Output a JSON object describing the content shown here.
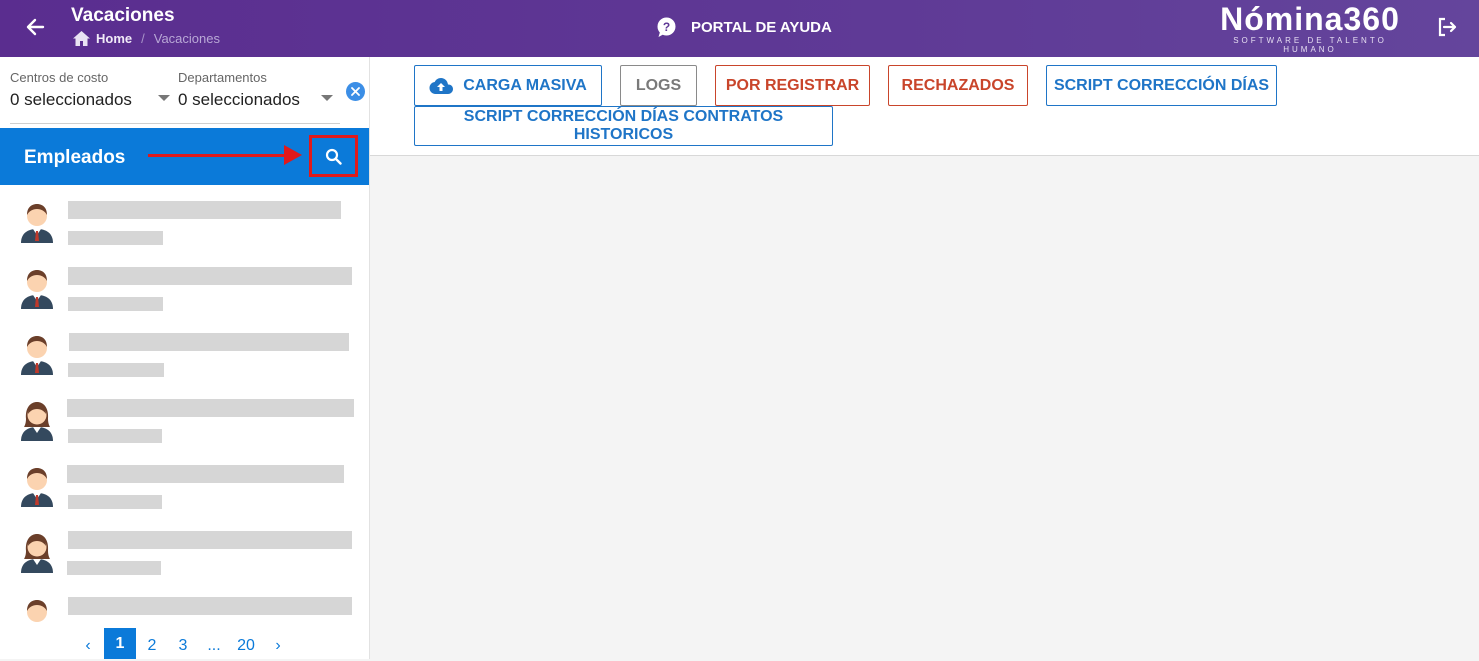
{
  "header": {
    "title": "Vacaciones",
    "breadcrumb": {
      "home": "Home",
      "separator": "/",
      "current": "Vacaciones"
    },
    "help_label": "PORTAL DE AYUDA",
    "brand": {
      "name": "Nómina360",
      "tagline": "SOFTWARE DE TALENTO HUMANO"
    },
    "icons": {
      "back": "arrow-left-icon",
      "home": "home-icon",
      "help": "help-circle-icon",
      "logout": "logout-icon"
    },
    "color": "#5e3795"
  },
  "filters": {
    "cost_centers": {
      "label": "Centros de costo",
      "value": "0 seleccionados"
    },
    "departments": {
      "label": "Departamentos",
      "value": "0 seleccionados"
    },
    "clear_icon": "clear-circle-icon"
  },
  "employees": {
    "title": "Empleados",
    "search_icon": "search-icon",
    "highlight_color": "#e0191b",
    "header_color": "#0b7ad9",
    "items": [
      {
        "avatar": "male-avatar"
      },
      {
        "avatar": "male-avatar"
      },
      {
        "avatar": "male-avatar"
      },
      {
        "avatar": "female-avatar"
      },
      {
        "avatar": "male-avatar"
      },
      {
        "avatar": "female-avatar"
      },
      {
        "avatar": "male-avatar"
      }
    ],
    "pagination": {
      "prev": "‹",
      "pages": [
        "1",
        "2",
        "3",
        "...",
        "20"
      ],
      "current": "1",
      "next": "›"
    }
  },
  "toolbar": {
    "carga_masiva": "CARGA MASIVA",
    "logs": "LOGS",
    "por_registrar": "POR REGISTRAR",
    "rechazados": "RECHAZADOS",
    "script_correccion": "SCRIPT CORRECCIÓN DÍAS",
    "script_historicos": "SCRIPT CORRECCIÓN DÍAS CONTRATOS HISTORICOS",
    "upload_icon": "cloud-upload-icon"
  }
}
